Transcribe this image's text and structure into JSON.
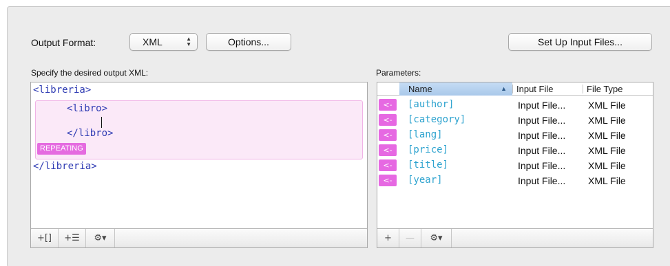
{
  "toolbar": {
    "output_format_label": "Output Format:",
    "format_value": "XML",
    "options_label": "Options...",
    "setup_label": "Set Up Input Files..."
  },
  "editor": {
    "heading": "Specify the desired output XML:",
    "root_open": "<libreria>",
    "child_open": "<libro>",
    "child_close": "</libro>",
    "repeat_badge": "REPEATING",
    "root_close": "</libreria>",
    "footer": {
      "add_bracket": "+[]",
      "add_list": "+☰",
      "gear": "⚙▾"
    }
  },
  "params": {
    "heading": "Parameters:",
    "columns": [
      "Name",
      "Input File",
      "File Type"
    ],
    "rows": [
      {
        "name": "[author]",
        "file": "Input File...",
        "type": "XML File"
      },
      {
        "name": "[category]",
        "file": "Input File...",
        "type": "XML File"
      },
      {
        "name": "[lang]",
        "file": "Input File...",
        "type": "XML File"
      },
      {
        "name": "[price]",
        "file": "Input File...",
        "type": "XML File"
      },
      {
        "name": "[title]",
        "file": "Input File...",
        "type": "XML File"
      },
      {
        "name": "[year]",
        "file": "Input File...",
        "type": "XML File"
      }
    ],
    "insert_arrow": "<-",
    "footer": {
      "add": "+",
      "remove": "—",
      "gear": "⚙▾"
    }
  },
  "colors": {
    "tag": "#2e3bb3",
    "param": "#2ea3cf",
    "repeat": "#e56be0",
    "sort_header": "#b8d3f0"
  }
}
